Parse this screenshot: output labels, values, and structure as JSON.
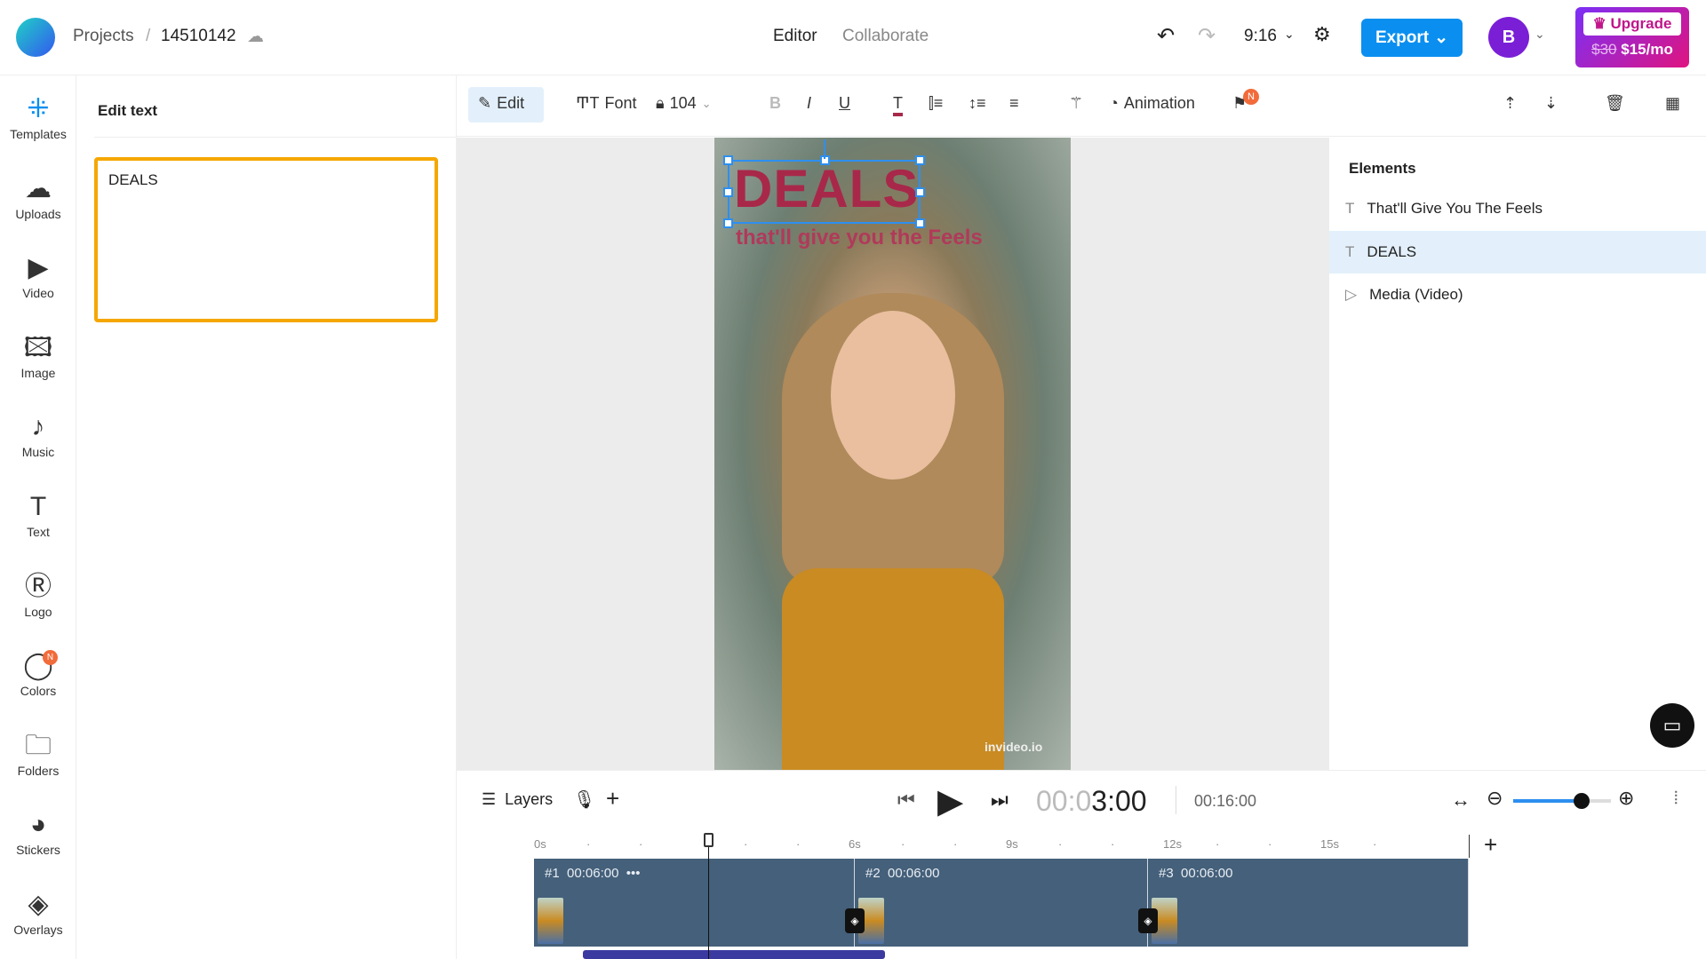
{
  "header": {
    "breadcrumb": [
      "Projects",
      "14510142"
    ],
    "nav": [
      "Editor",
      "Collaborate"
    ],
    "aspect": "9:16",
    "export_label": "Export",
    "avatar": "B",
    "upgrade": {
      "label": "Upgrade",
      "old_price": "$30",
      "price": "$15/mo"
    }
  },
  "rail": [
    {
      "label": "Templates",
      "icon": "grid-icon"
    },
    {
      "label": "Uploads",
      "icon": "cloud-upload-icon"
    },
    {
      "label": "Video",
      "icon": "video-icon"
    },
    {
      "label": "Image",
      "icon": "image-icon"
    },
    {
      "label": "Music",
      "icon": "music-icon"
    },
    {
      "label": "Text",
      "icon": "text-icon"
    },
    {
      "label": "Logo",
      "icon": "logo-icon"
    },
    {
      "label": "Colors",
      "icon": "palette-icon",
      "badge": "N"
    },
    {
      "label": "Folders",
      "icon": "folder-icon"
    },
    {
      "label": "Stickers",
      "icon": "sticker-icon"
    },
    {
      "label": "Overlays",
      "icon": "layers-icon"
    }
  ],
  "panel": {
    "title": "Edit text",
    "value": "DEALS"
  },
  "toolbar": {
    "edit": "Edit",
    "font": "Font",
    "size": "104",
    "animation": "Animation",
    "badge": "N"
  },
  "canvas": {
    "title": "DEALS",
    "subtitle": "that'll give you the Feels",
    "watermark": "invideo.io"
  },
  "elements": {
    "title": "Elements",
    "items": [
      "That'll Give You The Feels",
      "DEALS",
      "Media (Video)"
    ],
    "selected": 1
  },
  "timeline": {
    "layers": "Layers",
    "time_dim": "00:0",
    "time": "3:00",
    "duration": "00:16:00",
    "zoom_level": 0.7,
    "ruler": [
      "0s",
      "6s",
      "9s",
      "12s",
      "15s"
    ],
    "clips": [
      {
        "num": "#1",
        "dur": "00:06:00"
      },
      {
        "num": "#2",
        "dur": "00:06:00"
      },
      {
        "num": "#3",
        "dur": "00:06:00"
      }
    ]
  },
  "colors": {
    "accent": "#0a8ff0",
    "selection": "#f5a700",
    "clip": "#45607a"
  }
}
